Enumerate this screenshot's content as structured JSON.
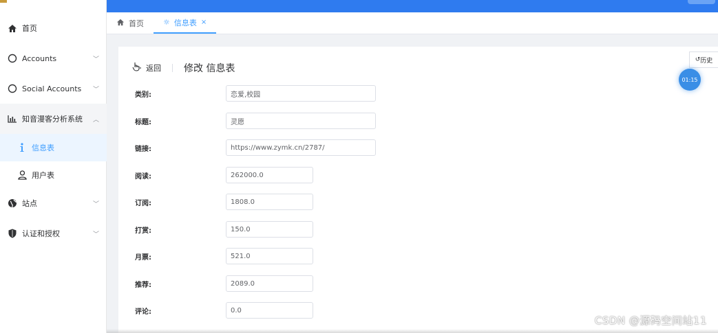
{
  "sidebar": {
    "items": [
      {
        "label": "首页",
        "icon": "home-icon"
      },
      {
        "label": "Accounts",
        "icon": "circle-icon",
        "arrow": "﹀"
      },
      {
        "label": "Social Accounts",
        "icon": "circle-icon",
        "arrow": "﹀"
      },
      {
        "label": "知音漫客分析系统",
        "icon": "bar-chart-icon",
        "arrow": "︿"
      },
      {
        "label": "信息表",
        "icon": "info-icon"
      },
      {
        "label": "用户表",
        "icon": "user-icon"
      },
      {
        "label": "站点",
        "icon": "globe-icon",
        "arrow": "﹀"
      },
      {
        "label": "认证和授权",
        "icon": "shield-icon",
        "arrow": "﹀"
      }
    ]
  },
  "tabs": [
    {
      "label": "首页",
      "icon": "home-icon"
    },
    {
      "label": "信息表",
      "icon": "gear-icon",
      "close": "×"
    }
  ],
  "page": {
    "back_label": "返回",
    "title": "修改 信息表",
    "history_label": "历史",
    "timer": "01:15"
  },
  "form": {
    "fields": [
      {
        "label": "类别:",
        "value": "恋爱,校园"
      },
      {
        "label": "标题:",
        "value": "灵愿"
      },
      {
        "label": "链接:",
        "value": "https://www.zymk.cn/2787/"
      },
      {
        "label": "阅读:",
        "value": "262000.0"
      },
      {
        "label": "订阅:",
        "value": "1808.0"
      },
      {
        "label": "打赏:",
        "value": "150.0"
      },
      {
        "label": "月票:",
        "value": "521.0"
      },
      {
        "label": "推荐:",
        "value": "2089.0"
      },
      {
        "label": "评论:",
        "value": "0.0"
      }
    ]
  },
  "watermark": "CSDN @源码空间站11",
  "colors": {
    "primary": "#409eff",
    "topbar": "#2f7bef"
  }
}
